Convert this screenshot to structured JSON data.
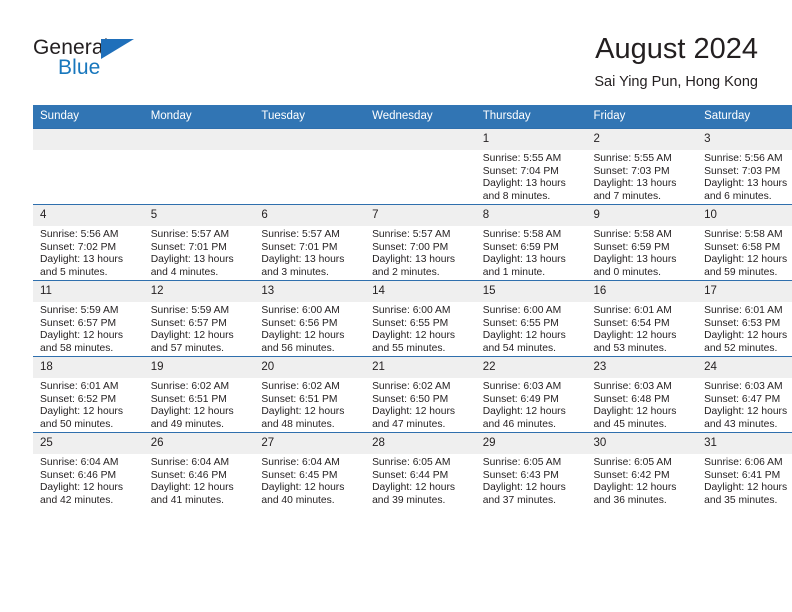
{
  "brand": {
    "name_part1": "General",
    "name_part2": "Blue",
    "accent_color": "#1877bd",
    "triangle_color": "#1f6fba"
  },
  "header": {
    "month_title": "August 2024",
    "location": "Sai Ying Pun, Hong Kong"
  },
  "calendar": {
    "header_bg": "#3175b4",
    "daynum_bg": "#efefef",
    "row_border_color": "#2f6fad",
    "weekdays": [
      "Sunday",
      "Monday",
      "Tuesday",
      "Wednesday",
      "Thursday",
      "Friday",
      "Saturday"
    ],
    "weeks": [
      [
        {
          "day": "",
          "sunrise": "",
          "sunset": "",
          "daylight": "",
          "empty": true
        },
        {
          "day": "",
          "sunrise": "",
          "sunset": "",
          "daylight": "",
          "empty": true
        },
        {
          "day": "",
          "sunrise": "",
          "sunset": "",
          "daylight": "",
          "empty": true
        },
        {
          "day": "",
          "sunrise": "",
          "sunset": "",
          "daylight": "",
          "empty": true
        },
        {
          "day": "1",
          "sunrise": "Sunrise: 5:55 AM",
          "sunset": "Sunset: 7:04 PM",
          "daylight": "Daylight: 13 hours and 8 minutes."
        },
        {
          "day": "2",
          "sunrise": "Sunrise: 5:55 AM",
          "sunset": "Sunset: 7:03 PM",
          "daylight": "Daylight: 13 hours and 7 minutes."
        },
        {
          "day": "3",
          "sunrise": "Sunrise: 5:56 AM",
          "sunset": "Sunset: 7:03 PM",
          "daylight": "Daylight: 13 hours and 6 minutes."
        }
      ],
      [
        {
          "day": "4",
          "sunrise": "Sunrise: 5:56 AM",
          "sunset": "Sunset: 7:02 PM",
          "daylight": "Daylight: 13 hours and 5 minutes."
        },
        {
          "day": "5",
          "sunrise": "Sunrise: 5:57 AM",
          "sunset": "Sunset: 7:01 PM",
          "daylight": "Daylight: 13 hours and 4 minutes."
        },
        {
          "day": "6",
          "sunrise": "Sunrise: 5:57 AM",
          "sunset": "Sunset: 7:01 PM",
          "daylight": "Daylight: 13 hours and 3 minutes."
        },
        {
          "day": "7",
          "sunrise": "Sunrise: 5:57 AM",
          "sunset": "Sunset: 7:00 PM",
          "daylight": "Daylight: 13 hours and 2 minutes."
        },
        {
          "day": "8",
          "sunrise": "Sunrise: 5:58 AM",
          "sunset": "Sunset: 6:59 PM",
          "daylight": "Daylight: 13 hours and 1 minute."
        },
        {
          "day": "9",
          "sunrise": "Sunrise: 5:58 AM",
          "sunset": "Sunset: 6:59 PM",
          "daylight": "Daylight: 13 hours and 0 minutes."
        },
        {
          "day": "10",
          "sunrise": "Sunrise: 5:58 AM",
          "sunset": "Sunset: 6:58 PM",
          "daylight": "Daylight: 12 hours and 59 minutes."
        }
      ],
      [
        {
          "day": "11",
          "sunrise": "Sunrise: 5:59 AM",
          "sunset": "Sunset: 6:57 PM",
          "daylight": "Daylight: 12 hours and 58 minutes."
        },
        {
          "day": "12",
          "sunrise": "Sunrise: 5:59 AM",
          "sunset": "Sunset: 6:57 PM",
          "daylight": "Daylight: 12 hours and 57 minutes."
        },
        {
          "day": "13",
          "sunrise": "Sunrise: 6:00 AM",
          "sunset": "Sunset: 6:56 PM",
          "daylight": "Daylight: 12 hours and 56 minutes."
        },
        {
          "day": "14",
          "sunrise": "Sunrise: 6:00 AM",
          "sunset": "Sunset: 6:55 PM",
          "daylight": "Daylight: 12 hours and 55 minutes."
        },
        {
          "day": "15",
          "sunrise": "Sunrise: 6:00 AM",
          "sunset": "Sunset: 6:55 PM",
          "daylight": "Daylight: 12 hours and 54 minutes."
        },
        {
          "day": "16",
          "sunrise": "Sunrise: 6:01 AM",
          "sunset": "Sunset: 6:54 PM",
          "daylight": "Daylight: 12 hours and 53 minutes."
        },
        {
          "day": "17",
          "sunrise": "Sunrise: 6:01 AM",
          "sunset": "Sunset: 6:53 PM",
          "daylight": "Daylight: 12 hours and 52 minutes."
        }
      ],
      [
        {
          "day": "18",
          "sunrise": "Sunrise: 6:01 AM",
          "sunset": "Sunset: 6:52 PM",
          "daylight": "Daylight: 12 hours and 50 minutes."
        },
        {
          "day": "19",
          "sunrise": "Sunrise: 6:02 AM",
          "sunset": "Sunset: 6:51 PM",
          "daylight": "Daylight: 12 hours and 49 minutes."
        },
        {
          "day": "20",
          "sunrise": "Sunrise: 6:02 AM",
          "sunset": "Sunset: 6:51 PM",
          "daylight": "Daylight: 12 hours and 48 minutes."
        },
        {
          "day": "21",
          "sunrise": "Sunrise: 6:02 AM",
          "sunset": "Sunset: 6:50 PM",
          "daylight": "Daylight: 12 hours and 47 minutes."
        },
        {
          "day": "22",
          "sunrise": "Sunrise: 6:03 AM",
          "sunset": "Sunset: 6:49 PM",
          "daylight": "Daylight: 12 hours and 46 minutes."
        },
        {
          "day": "23",
          "sunrise": "Sunrise: 6:03 AM",
          "sunset": "Sunset: 6:48 PM",
          "daylight": "Daylight: 12 hours and 45 minutes."
        },
        {
          "day": "24",
          "sunrise": "Sunrise: 6:03 AM",
          "sunset": "Sunset: 6:47 PM",
          "daylight": "Daylight: 12 hours and 43 minutes."
        }
      ],
      [
        {
          "day": "25",
          "sunrise": "Sunrise: 6:04 AM",
          "sunset": "Sunset: 6:46 PM",
          "daylight": "Daylight: 12 hours and 42 minutes."
        },
        {
          "day": "26",
          "sunrise": "Sunrise: 6:04 AM",
          "sunset": "Sunset: 6:46 PM",
          "daylight": "Daylight: 12 hours and 41 minutes."
        },
        {
          "day": "27",
          "sunrise": "Sunrise: 6:04 AM",
          "sunset": "Sunset: 6:45 PM",
          "daylight": "Daylight: 12 hours and 40 minutes."
        },
        {
          "day": "28",
          "sunrise": "Sunrise: 6:05 AM",
          "sunset": "Sunset: 6:44 PM",
          "daylight": "Daylight: 12 hours and 39 minutes."
        },
        {
          "day": "29",
          "sunrise": "Sunrise: 6:05 AM",
          "sunset": "Sunset: 6:43 PM",
          "daylight": "Daylight: 12 hours and 37 minutes."
        },
        {
          "day": "30",
          "sunrise": "Sunrise: 6:05 AM",
          "sunset": "Sunset: 6:42 PM",
          "daylight": "Daylight: 12 hours and 36 minutes."
        },
        {
          "day": "31",
          "sunrise": "Sunrise: 6:06 AM",
          "sunset": "Sunset: 6:41 PM",
          "daylight": "Daylight: 12 hours and 35 minutes."
        }
      ]
    ]
  }
}
